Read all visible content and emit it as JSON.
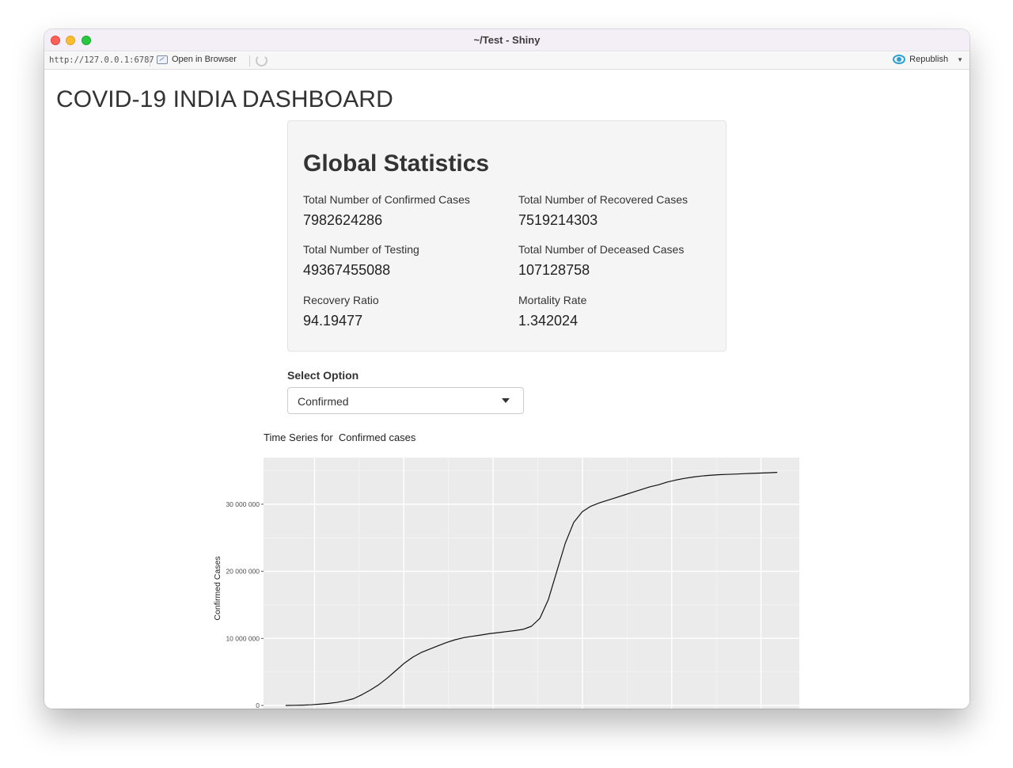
{
  "window": {
    "title": "~/Test - Shiny"
  },
  "toolbar": {
    "url": "http://127.0.0.1:6787",
    "open_in_browser": "Open in Browser",
    "republish": "Republish"
  },
  "page": {
    "title": "COVID-19 INDIA DASHBOARD"
  },
  "stats": {
    "heading": "Global Statistics",
    "items": [
      {
        "label": "Total Number of Confirmed Cases",
        "value": "7982624286"
      },
      {
        "label": "Total Number of Recovered Cases",
        "value": "7519214303"
      },
      {
        "label": "Total Number of Testing",
        "value": "49367455088"
      },
      {
        "label": "Total Number of Deceased Cases",
        "value": "107128758"
      },
      {
        "label": "Recovery Ratio",
        "value": "94.19477"
      },
      {
        "label": "Mortality Rate",
        "value": "1.342024"
      }
    ]
  },
  "select": {
    "label": "Select Option",
    "value": "Confirmed"
  },
  "chart_caption": "Time Series for  Confirmed cases",
  "chart_data": {
    "type": "line",
    "title": "",
    "xlabel": "",
    "ylabel": "Confirmed  Cases",
    "ylim": [
      0,
      35000000
    ],
    "y_ticks": [
      {
        "value": 0,
        "label": "0"
      },
      {
        "value": 10000000,
        "label": "10 000 000"
      },
      {
        "value": 20000000,
        "label": "20 000 000"
      },
      {
        "value": 30000000,
        "label": "30 000 000"
      }
    ],
    "grid": true,
    "series": [
      {
        "x": [
          0,
          10,
          20,
          30,
          40,
          50,
          60,
          70,
          80,
          90,
          100,
          110,
          120,
          130,
          140,
          150,
          160,
          170,
          180,
          190,
          200,
          210,
          220,
          230,
          240,
          250,
          260,
          270,
          280,
          290,
          300,
          310,
          320,
          330,
          340,
          350,
          360,
          370,
          380,
          390,
          400,
          410,
          420,
          430,
          440,
          450,
          460,
          470,
          480,
          490,
          500,
          510,
          520,
          530,
          540,
          550,
          560,
          570,
          580
        ],
        "y": [
          0,
          20000,
          50000,
          100000,
          190000,
          300000,
          450000,
          680000,
          1000000,
          1600000,
          2300000,
          3100000,
          4100000,
          5200000,
          6300000,
          7200000,
          7900000,
          8400000,
          8900000,
          9400000,
          9800000,
          10100000,
          10300000,
          10500000,
          10700000,
          10850000,
          11000000,
          11150000,
          11350000,
          11800000,
          13000000,
          15800000,
          20000000,
          24200000,
          27300000,
          28900000,
          29700000,
          30200000,
          30600000,
          31000000,
          31400000,
          31800000,
          32200000,
          32600000,
          32900000,
          33300000,
          33600000,
          33850000,
          34050000,
          34200000,
          34300000,
          34400000,
          34450000,
          34500000,
          34550000,
          34600000,
          34650000,
          34700000,
          34750000
        ]
      }
    ]
  }
}
